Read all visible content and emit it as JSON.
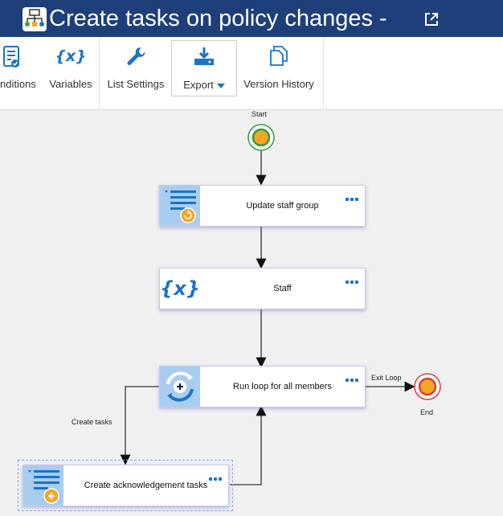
{
  "window": {
    "title": "Create tasks on policy changes -",
    "app_icon": "workflow-icon",
    "popout_icon": "popout-icon"
  },
  "ribbon": {
    "items": [
      {
        "label": "nditions",
        "icon": "conditions-icon"
      },
      {
        "label": "Variables",
        "icon": "variables-icon"
      },
      {
        "label": "List Settings",
        "icon": "wrench-icon"
      },
      {
        "label": "Export",
        "icon": "download-icon"
      },
      {
        "label": "Version History",
        "icon": "copy-pages-icon"
      }
    ]
  },
  "flow": {
    "start_label": "Start",
    "end_label": "End",
    "nodes": [
      {
        "label": "Update staff group",
        "icon": "list-update-icon"
      },
      {
        "label": "Staff",
        "icon": "variables-icon"
      },
      {
        "label": "Run loop for all members",
        "icon": "loop-icon"
      },
      {
        "label": "Create acknowledgement tasks",
        "icon": "list-add-icon"
      }
    ],
    "edge_labels": {
      "exit_loop": "Exit Loop",
      "create_tasks": "Create tasks"
    }
  },
  "colors": {
    "titlebar": "#1f3f7a",
    "accent": "#1b73c6",
    "start": "#2e9e3a",
    "end": "#e23b3b",
    "node_fill": "#f5a623"
  }
}
